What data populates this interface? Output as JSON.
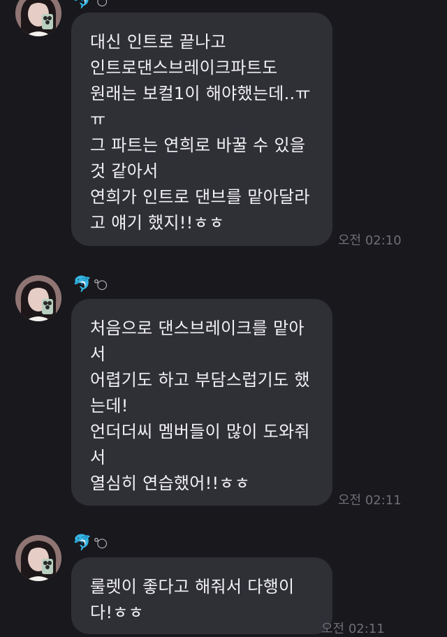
{
  "sender": {
    "emoji": "🐬",
    "rings": "°○"
  },
  "messages": [
    {
      "lines": [
        "대신 인트로 끝나고",
        "인트로댄스브레이크파트도",
        "원래는 보컬1이 해야했는데..ㅠ",
        "ㅠ",
        "그 파트는 연희로 바꿀 수 있을",
        "것 같아서",
        "연희가 인트로 댄브를 맡아달라",
        "고 얘기 했지!!ㅎㅎ"
      ],
      "time": "오전 02:10"
    },
    {
      "lines": [
        "처음으로 댄스브레이크를 맡아",
        "서",
        "어렵기도 하고 부담스럽기도 했",
        "는데!",
        "언더더씨 멤버들이 많이 도와줘",
        "서",
        "열심히 연습했어!!ㅎㅎ"
      ],
      "time": "오전 02:11"
    },
    {
      "lines": [
        "룰렛이 좋다고 해줘서 다행이",
        "다!ㅎㅎ"
      ],
      "time": "오전 02:11"
    }
  ]
}
